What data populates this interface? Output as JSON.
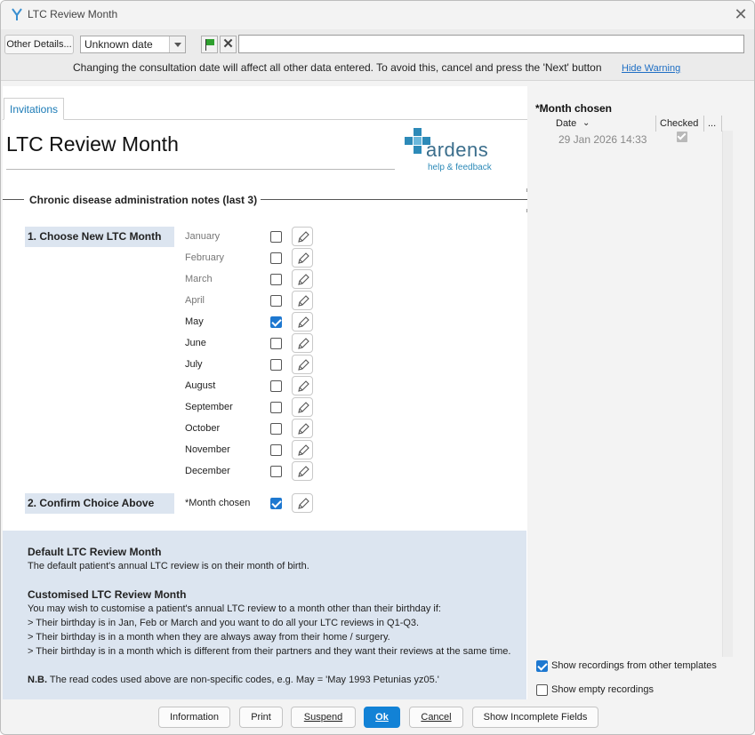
{
  "window": {
    "title": "LTC Review Month",
    "close_glyph": "✕"
  },
  "toolbar": {
    "other_details_label": "Other Details...",
    "date_value": "Unknown date",
    "free_text_value": "",
    "warning": "Changing the consultation date will affect all other data entered. To avoid this, cancel and press the 'Next' button",
    "hide_warning_label": "Hide Warning",
    "cancel_glyph": "✕"
  },
  "tabs": [
    {
      "label": "Invitations",
      "active": true
    }
  ],
  "page": {
    "title": "LTC Review Month",
    "logo_text": "ardens",
    "logo_link": "help & feedback",
    "section_title": "Chronic disease administration notes (last 3)"
  },
  "steps": [
    {
      "label": "1. Choose New LTC Month"
    },
    {
      "label": "2. Confirm Choice Above"
    }
  ],
  "months": [
    {
      "label": "January",
      "checked": false,
      "dim": true
    },
    {
      "label": "February",
      "checked": false,
      "dim": true
    },
    {
      "label": "March",
      "checked": false,
      "dim": true
    },
    {
      "label": "April",
      "checked": false,
      "dim": true
    },
    {
      "label": "May",
      "checked": true,
      "dim": false
    },
    {
      "label": "June",
      "checked": false,
      "dim": false
    },
    {
      "label": "July",
      "checked": false,
      "dim": false
    },
    {
      "label": "August",
      "checked": false,
      "dim": false
    },
    {
      "label": "September",
      "checked": false,
      "dim": false
    },
    {
      "label": "October",
      "checked": false,
      "dim": false
    },
    {
      "label": "November",
      "checked": false,
      "dim": false
    },
    {
      "label": "December",
      "checked": false,
      "dim": false
    }
  ],
  "confirm": {
    "label": "*Month chosen",
    "checked": true
  },
  "info": {
    "default_heading": "Default LTC Review Month",
    "default_text": "The default patient's annual LTC review is on their month of birth.",
    "custom_heading": "Customised LTC Review Month",
    "custom_intro": "You may wish to customise a patient's annual LTC review to a month other than their birthday if:",
    "bullets": [
      "> Their birthday is in Jan, Feb or March and you want to do all your LTC reviews in Q1-Q3.",
      "> Their birthday is in a month when they are always away from their home / surgery.",
      "> Their birthday is in a month which is different from their partners and they want their reviews at the same time."
    ],
    "nb_label": "N.B.",
    "nb_text": "The read codes used above are non-specific codes, e.g. May = 'May 1993 Petunias yz05.'"
  },
  "right_panel": {
    "title": "*Month chosen",
    "columns": {
      "date": "Date",
      "checked": "Checked",
      "more": "..."
    },
    "rows": [
      {
        "date": "29 Jan 2026 14:33",
        "checked": true
      }
    ],
    "show_other_templates": {
      "label": "Show recordings from other templates",
      "checked": true
    },
    "show_empty": {
      "label": "Show empty recordings",
      "checked": false
    }
  },
  "bottom_buttons": {
    "information": "Information",
    "print": "Print",
    "suspend": "Suspend",
    "ok": "Ok",
    "cancel": "Cancel",
    "show_incomplete": "Show Incomplete Fields"
  },
  "colors": {
    "accent": "#1282d6",
    "step_bg": "#dce5f0",
    "logo_blue": "#2d8ab8"
  }
}
